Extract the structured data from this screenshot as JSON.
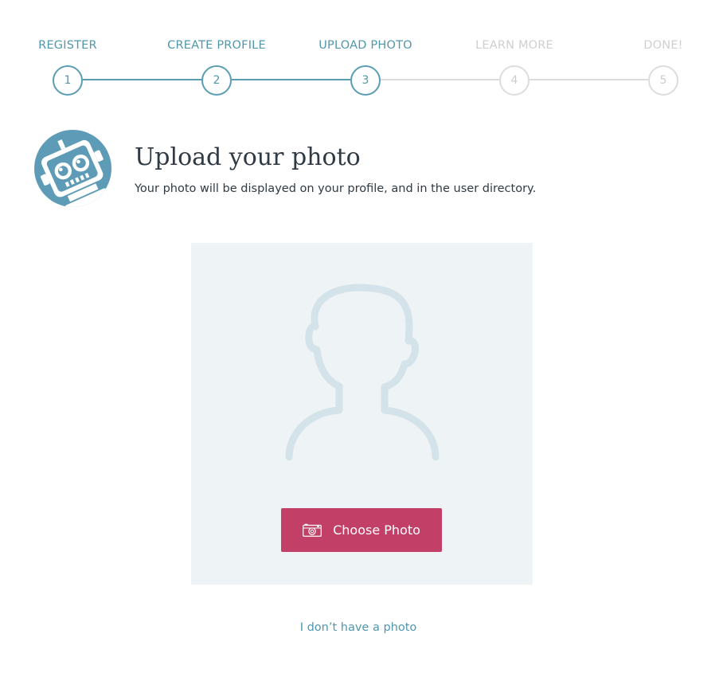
{
  "stepper": {
    "steps": [
      {
        "label": "REGISTER",
        "number": "1",
        "state": "active"
      },
      {
        "label": "CREATE PROFILE",
        "number": "2",
        "state": "active"
      },
      {
        "label": "UPLOAD PHOTO",
        "number": "3",
        "state": "active"
      },
      {
        "label": "LEARN MORE",
        "number": "4",
        "state": "inactive"
      },
      {
        "label": "DONE!",
        "number": "5",
        "state": "inactive"
      }
    ],
    "current_step": 3,
    "total_steps": 5
  },
  "header": {
    "title": "Upload your photo",
    "subtitle": "Your photo will be displayed on your profile, and in the user directory.",
    "avatar_icon": "robot-mascot-icon"
  },
  "upload": {
    "placeholder_icon": "person-silhouette-icon",
    "button_label": "Choose Photo",
    "button_icon": "camera-icon"
  },
  "skip_link": {
    "label": "I don’t have a photo"
  },
  "colors": {
    "accent": "#5b9db3",
    "link": "#4f97ad",
    "inactive": "#dcdcdc",
    "primary_button": "#c23f67",
    "photo_background": "#eef3f5",
    "silhouette": "#d3e3e9"
  }
}
